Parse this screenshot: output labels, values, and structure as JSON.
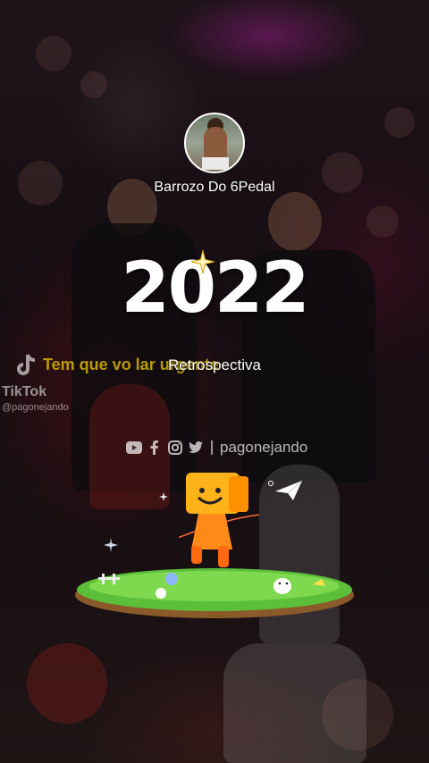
{
  "profile": {
    "username": "Barrozo Do 6Pedal"
  },
  "headline": {
    "year": "2022",
    "subtitle": "Retrospectiva"
  },
  "lyric": {
    "text": "Tem que vo                               lar urgente"
  },
  "watermark": {
    "app_name": "TikTok",
    "handle": "@pagonejando"
  },
  "social_bar": {
    "icons": [
      "youtube-icon",
      "facebook-icon",
      "instagram-icon",
      "twitter-icon"
    ],
    "handle": "pagonejando"
  },
  "colors": {
    "lyric_yellow": "#d8b400",
    "mascot_orange": "#ff9a1a",
    "grass_green": "#5cbf3a"
  }
}
